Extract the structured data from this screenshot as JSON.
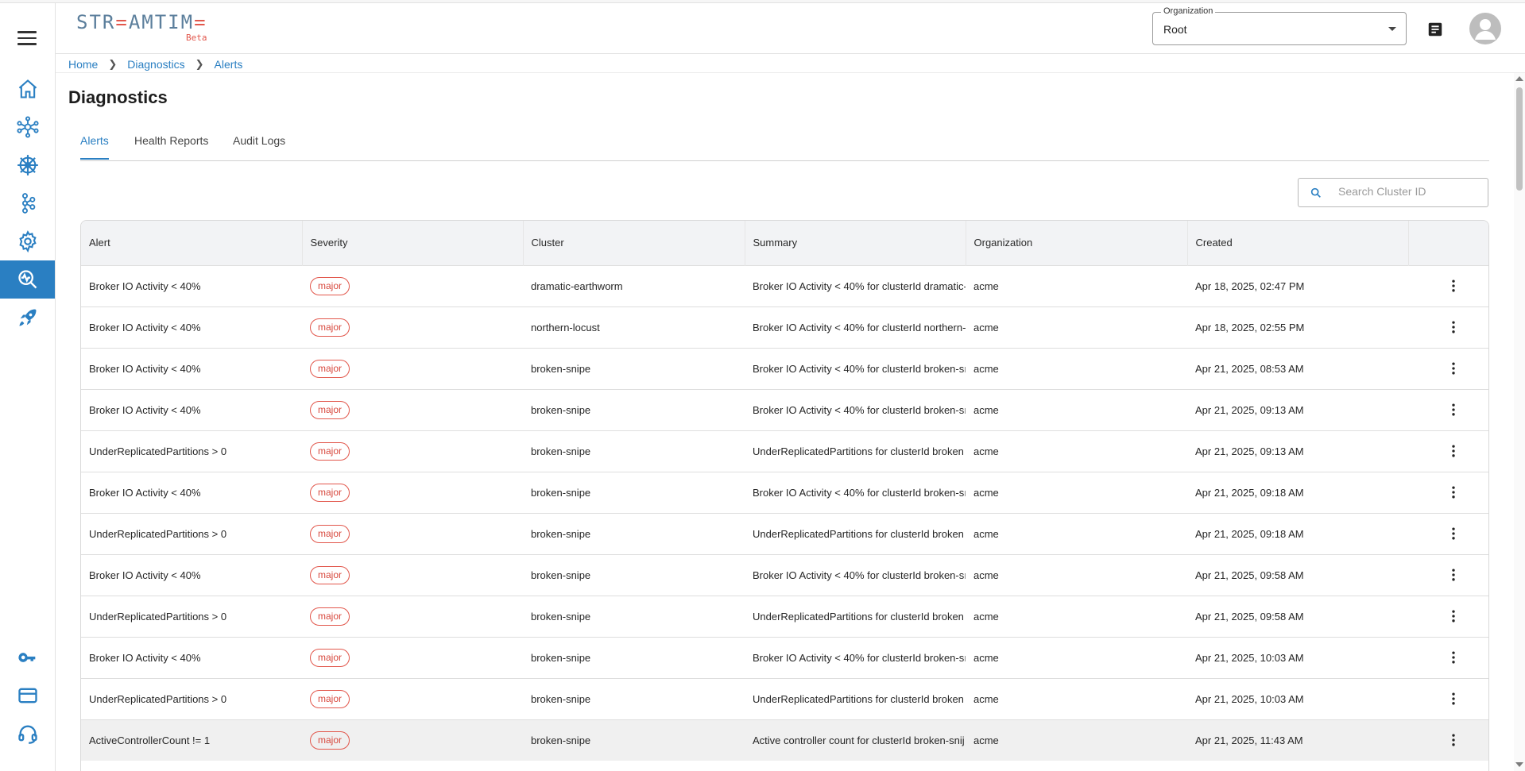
{
  "header": {
    "logo_text": "STREAMTIME",
    "logo_beta": "Beta",
    "org_label": "Organization",
    "org_value": "Root"
  },
  "breadcrumb": [
    "Home",
    "Diagnostics",
    "Alerts"
  ],
  "page_title": "Diagnostics",
  "tabs": [
    {
      "label": "Alerts",
      "active": true
    },
    {
      "label": "Health Reports",
      "active": false
    },
    {
      "label": "Audit Logs",
      "active": false
    }
  ],
  "search": {
    "placeholder": "Search Cluster ID",
    "value": ""
  },
  "table": {
    "columns": [
      "Alert",
      "Severity",
      "Cluster",
      "Summary",
      "Organization",
      "Created"
    ],
    "rows": [
      {
        "alert": "Broker IO Activity < 40%",
        "severity": "major",
        "cluster": "dramatic-earthworm",
        "summary": "Broker IO Activity < 40% for clusterId dramatic-",
        "organization": "acme",
        "created": "Apr 18, 2025, 02:47 PM"
      },
      {
        "alert": "Broker IO Activity < 40%",
        "severity": "major",
        "cluster": "northern-locust",
        "summary": "Broker IO Activity < 40% for clusterId northern-",
        "organization": "acme",
        "created": "Apr 18, 2025, 02:55 PM"
      },
      {
        "alert": "Broker IO Activity < 40%",
        "severity": "major",
        "cluster": "broken-snipe",
        "summary": "Broker IO Activity < 40% for clusterId broken-sı",
        "organization": "acme",
        "created": "Apr 21, 2025, 08:53 AM"
      },
      {
        "alert": "Broker IO Activity < 40%",
        "severity": "major",
        "cluster": "broken-snipe",
        "summary": "Broker IO Activity < 40% for clusterId broken-sı",
        "organization": "acme",
        "created": "Apr 21, 2025, 09:13 AM"
      },
      {
        "alert": "UnderReplicatedPartitions > 0",
        "severity": "major",
        "cluster": "broken-snipe",
        "summary": "UnderReplicatedPartitions for clusterId broken",
        "organization": "acme",
        "created": "Apr 21, 2025, 09:13 AM"
      },
      {
        "alert": "Broker IO Activity < 40%",
        "severity": "major",
        "cluster": "broken-snipe",
        "summary": "Broker IO Activity < 40% for clusterId broken-sı",
        "organization": "acme",
        "created": "Apr 21, 2025, 09:18 AM"
      },
      {
        "alert": "UnderReplicatedPartitions > 0",
        "severity": "major",
        "cluster": "broken-snipe",
        "summary": "UnderReplicatedPartitions for clusterId broken",
        "organization": "acme",
        "created": "Apr 21, 2025, 09:18 AM"
      },
      {
        "alert": "Broker IO Activity < 40%",
        "severity": "major",
        "cluster": "broken-snipe",
        "summary": "Broker IO Activity < 40% for clusterId broken-sı",
        "organization": "acme",
        "created": "Apr 21, 2025, 09:58 AM"
      },
      {
        "alert": "UnderReplicatedPartitions > 0",
        "severity": "major",
        "cluster": "broken-snipe",
        "summary": "UnderReplicatedPartitions for clusterId broken",
        "organization": "acme",
        "created": "Apr 21, 2025, 09:58 AM"
      },
      {
        "alert": "Broker IO Activity < 40%",
        "severity": "major",
        "cluster": "broken-snipe",
        "summary": "Broker IO Activity < 40% for clusterId broken-sı",
        "organization": "acme",
        "created": "Apr 21, 2025, 10:03 AM"
      },
      {
        "alert": "UnderReplicatedPartitions > 0",
        "severity": "major",
        "cluster": "broken-snipe",
        "summary": "UnderReplicatedPartitions for clusterId broken",
        "organization": "acme",
        "created": "Apr 21, 2025, 10:03 AM"
      },
      {
        "alert": "ActiveControllerCount != 1",
        "severity": "major",
        "cluster": "broken-snipe",
        "summary": "Active controller count for clusterId broken-snij",
        "organization": "acme",
        "created": "Apr 21, 2025, 11:43 AM",
        "highlighted": true
      }
    ]
  },
  "sidebar": {
    "items": [
      {
        "icon": "home-icon",
        "active": false
      },
      {
        "icon": "network-icon",
        "active": false
      },
      {
        "icon": "helm-wheel-icon",
        "active": false
      },
      {
        "icon": "nodes-icon",
        "active": false
      },
      {
        "icon": "gear-icon",
        "active": false
      },
      {
        "icon": "diagnostics-search-icon",
        "active": true
      },
      {
        "icon": "rocket-icon",
        "active": false
      }
    ],
    "bottom_items": [
      {
        "icon": "key-icon"
      },
      {
        "icon": "credit-card-icon"
      },
      {
        "icon": "support-headset-icon"
      }
    ]
  },
  "colors": {
    "accent": "#2a7fc2",
    "severity_major": "#e2574c",
    "logo": "#5c7f9c"
  }
}
